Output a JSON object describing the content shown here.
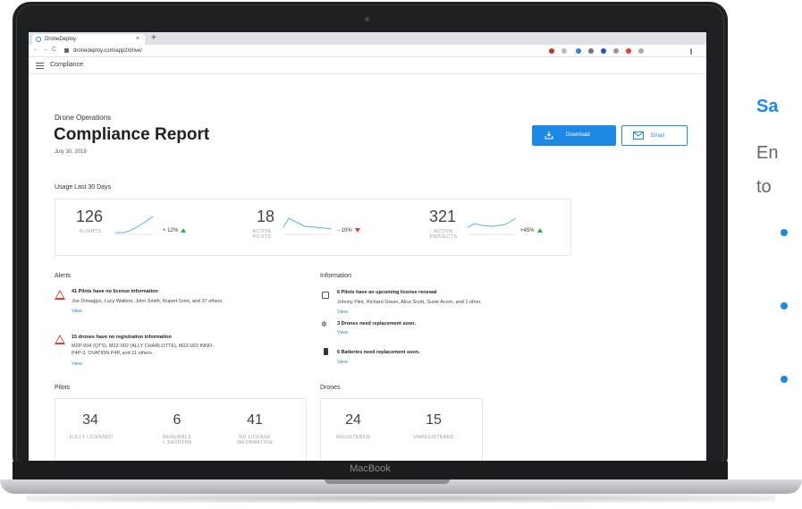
{
  "browser": {
    "tab_title": "DroneDeploy",
    "tab_close": "×",
    "new_tab": "+",
    "url": "dronedeploy.com/app2/drive/",
    "nav_back": "←",
    "nav_forward": "→",
    "nav_reload": "C"
  },
  "app": {
    "section": "Compliance"
  },
  "report": {
    "kicker": "Drone Operations",
    "title": "Compliance Report",
    "date": "July 30, 2019",
    "download_label": "Download",
    "email_label": "Email"
  },
  "usage": {
    "heading": "Usage Last 30 Days",
    "stats": [
      {
        "value": "126",
        "caption": "FLIGHTS",
        "delta": "+ 12%",
        "trend": "up"
      },
      {
        "value": "18",
        "caption": "ACTIVE PILOTS",
        "delta": "- 10%",
        "trend": "down"
      },
      {
        "value": "321",
        "caption": "ACTIVE PROJECTS",
        "delta": "+45%",
        "trend": "up"
      }
    ]
  },
  "alerts": {
    "heading": "Alerts",
    "items": [
      {
        "title": "41 Pilots have no license information",
        "text": "Joe Dimaggio, Lucy Walters, John Smith, Rupert Grint, and 37 others.",
        "text2": "",
        "link": "View"
      },
      {
        "title": "15 drones have no registration information",
        "text": "M2P-004 (QTS), M2Z-002 (ALLY CHARLOTTE), M2Z-002 INNO-",
        "text2": "P4P-3, OVATION P4P, and 11 others.",
        "link": "View"
      }
    ]
  },
  "information": {
    "heading": "Information",
    "items": [
      {
        "title": "6 Pilots have an upcoming license renewal",
        "text": "Johnny Flint, Richard Green, Alice Scott, Susie Acorn, and 1 other.",
        "link": "View"
      },
      {
        "title": "3 Drones need replacement soon.",
        "text": "",
        "link": "View"
      },
      {
        "title": "6 Batteries need replacement soon.",
        "text": "",
        "link": "View"
      }
    ]
  },
  "pilots": {
    "heading": "Pilots",
    "stats": [
      {
        "value": "34",
        "caption": "FULLY LICENSED"
      },
      {
        "value": "6",
        "caption": "RENEWALS",
        "caption2": "< 3MONTHS"
      },
      {
        "value": "41",
        "caption": "NO LICENSE",
        "caption2": "INFORMATION"
      }
    ]
  },
  "drones": {
    "heading": "Drones",
    "stats": [
      {
        "value": "24",
        "caption": "REGISTERED"
      },
      {
        "value": "15",
        "caption": "UNREGISTERED"
      }
    ]
  },
  "laptop": {
    "brand": "MacBook"
  },
  "slide": {
    "title_fragment": "Sa",
    "line1": "En",
    "line2": "to"
  },
  "colors": {
    "accent": "#1e88e5",
    "positive": "#2fb344",
    "negative": "#e53935"
  }
}
